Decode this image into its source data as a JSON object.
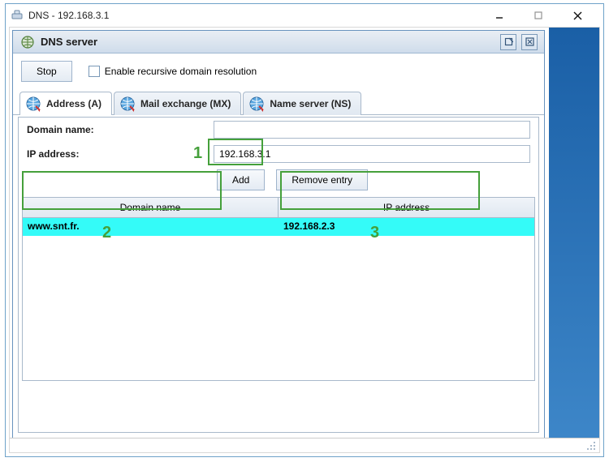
{
  "outer": {
    "title": "DNS - 192.168.3.1"
  },
  "mdi": {
    "title": "DNS server"
  },
  "toolbar": {
    "stop_label": "Stop",
    "recursive_label": "Enable recursive domain resolution"
  },
  "tabs": {
    "a": "Address (A)",
    "mx": "Mail exchange (MX)",
    "ns": "Name server (NS)"
  },
  "form": {
    "domain_label": "Domain name:",
    "ip_label": "IP address:",
    "domain_value": "",
    "ip_value": "192.168.3.1",
    "add_label": "Add",
    "remove_label": "Remove entry"
  },
  "grid": {
    "col_domain": "Domain name",
    "col_ip": "IP address",
    "rows": [
      {
        "domain": "www.snt.fr.",
        "ip": "192.168.2.3"
      }
    ]
  },
  "annot": {
    "one": "1",
    "two": "2",
    "three": "3"
  }
}
